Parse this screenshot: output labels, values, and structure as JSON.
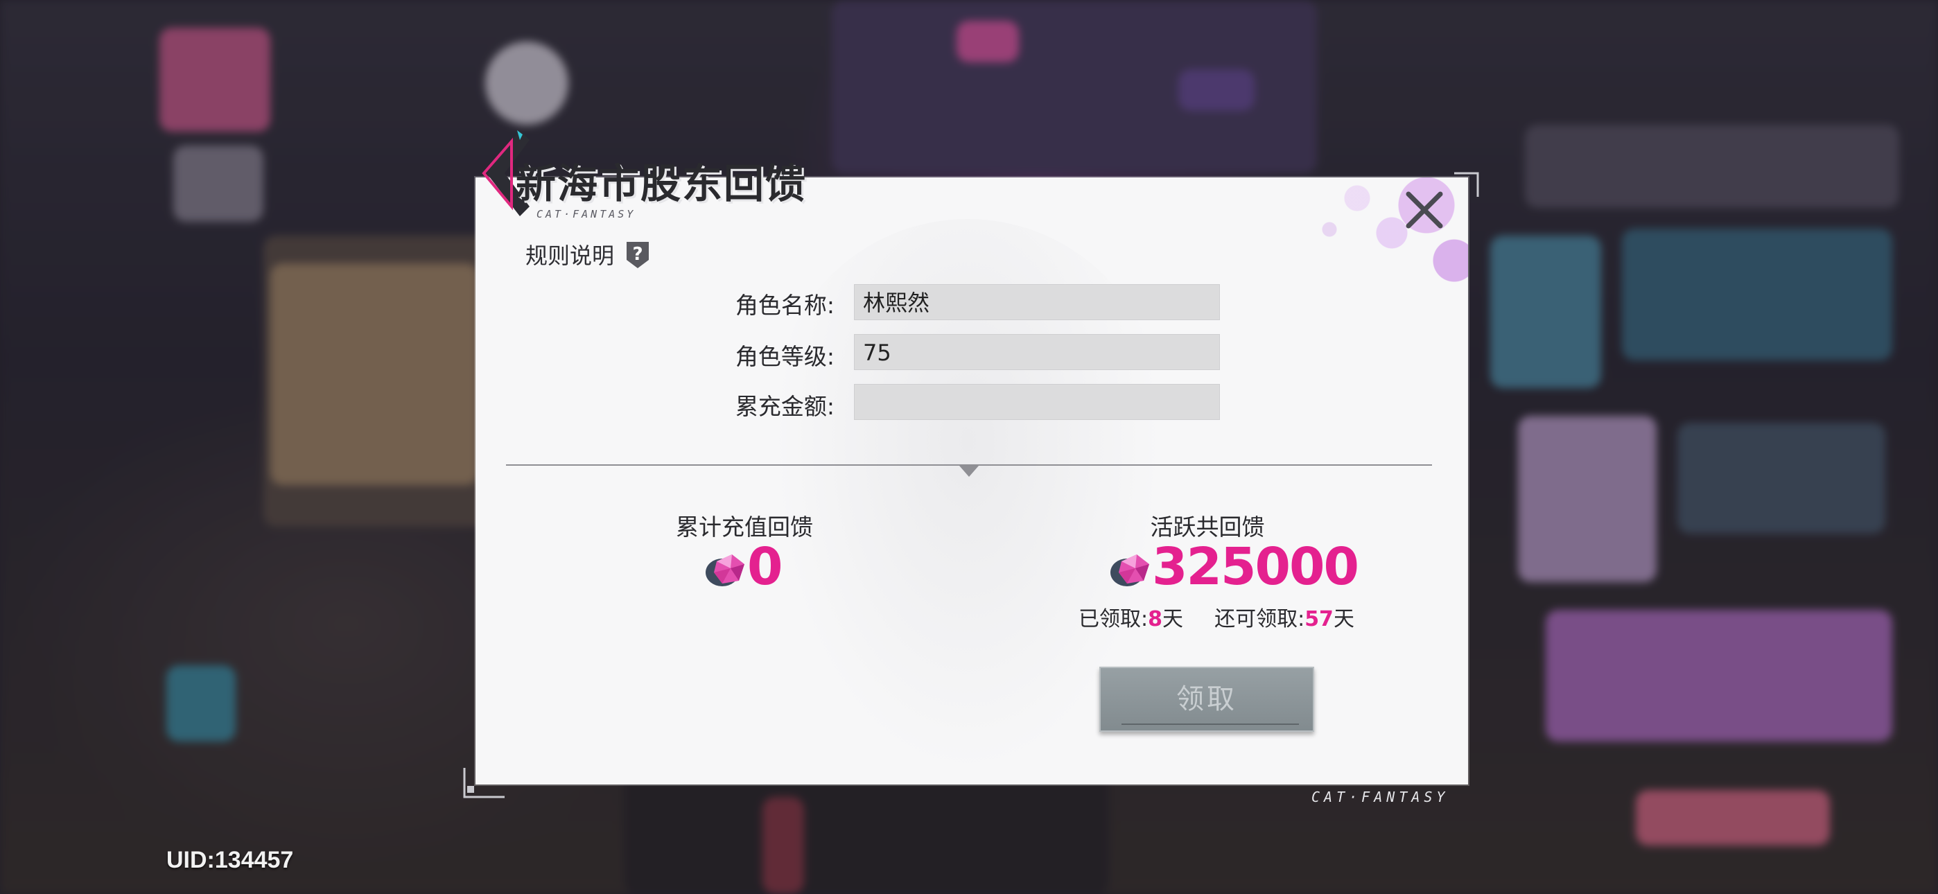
{
  "modal": {
    "title": "新海市股东回馈",
    "title_sub": "CAT·FANTASY",
    "rules_label": "规则说明",
    "form": {
      "name_label": "角色名称:",
      "name_value": "林熙然",
      "level_label": "角色等级:",
      "level_value": "75",
      "recharge_label": "累充金额:",
      "recharge_value": ""
    },
    "left_column": {
      "title": "累计充值回馈",
      "amount": "0"
    },
    "right_column": {
      "title": "活跃共回馈",
      "amount": "325000",
      "claimed_label": "已领取:",
      "claimed_days": "8",
      "claimed_unit": "天",
      "remaining_label": "还可领取:",
      "remaining_days": "57",
      "remaining_unit": "天"
    },
    "claim_button": "领取"
  },
  "footer": {
    "brand": "CAT·FANTASY",
    "uid": "UID:134457"
  },
  "colors": {
    "accent_pink": "#e4218f",
    "modal_bg": "#f7f7f8",
    "button_disabled": "#8a9397"
  },
  "icons": {
    "close": "close-x-icon",
    "rules": "question-shield-icon",
    "gem": "pink-diamond-gem-icon"
  }
}
